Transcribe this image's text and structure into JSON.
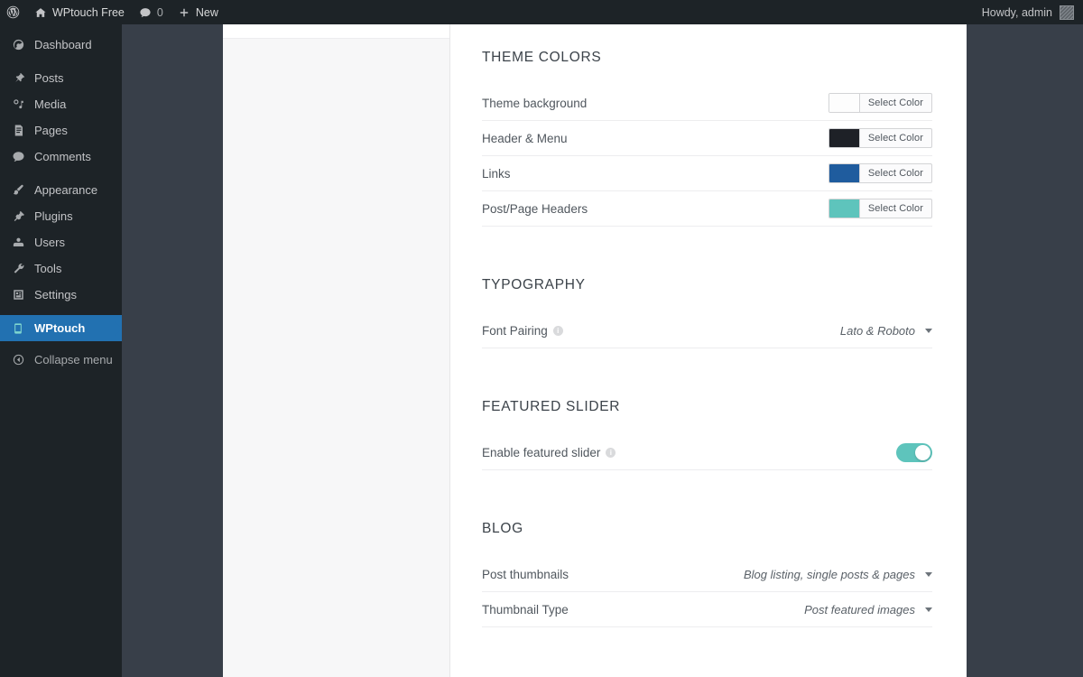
{
  "adminbar": {
    "logo_icon": "wordpress-logo-icon",
    "site_icon": "home-icon",
    "site_name": "WPtouch Free",
    "comments_icon": "comment-bubble-icon",
    "comments_count": "0",
    "new_icon": "plus-icon",
    "new_label": "New",
    "howdy": "Howdy, admin",
    "avatar_name": "user-avatar"
  },
  "sidebar": {
    "items": [
      {
        "label": "Dashboard",
        "icon": "dashboard-icon",
        "active": false
      },
      {
        "label": "Posts",
        "icon": "pin-icon",
        "active": false
      },
      {
        "label": "Media",
        "icon": "media-icon",
        "active": false
      },
      {
        "label": "Pages",
        "icon": "page-icon",
        "active": false
      },
      {
        "label": "Comments",
        "icon": "comment-bubble-icon",
        "active": false
      },
      {
        "label": "Appearance",
        "icon": "paintbrush-icon",
        "active": false
      },
      {
        "label": "Plugins",
        "icon": "plug-icon",
        "active": false
      },
      {
        "label": "Users",
        "icon": "users-icon",
        "active": false
      },
      {
        "label": "Tools",
        "icon": "wrench-icon",
        "active": false
      },
      {
        "label": "Settings",
        "icon": "settings-sliders-icon",
        "active": false
      },
      {
        "label": "WPtouch",
        "icon": "wptouch-icon",
        "active": true
      }
    ],
    "collapse": {
      "label": "Collapse menu",
      "icon": "collapse-arrow-icon"
    }
  },
  "main": {
    "sections": [
      {
        "title": "THEME COLORS",
        "rows": [
          {
            "label": "Theme background",
            "control": "colorpicker",
            "button_label": "Select Color",
            "swatch": "#fdfdfd"
          },
          {
            "label": "Header & Menu",
            "control": "colorpicker",
            "button_label": "Select Color",
            "swatch": "#1e2127"
          },
          {
            "label": "Links",
            "control": "colorpicker",
            "button_label": "Select Color",
            "swatch": "#1f5c9e"
          },
          {
            "label": "Post/Page Headers",
            "control": "colorpicker",
            "button_label": "Select Color",
            "swatch": "#5ec4bc"
          }
        ]
      },
      {
        "title": "TYPOGRAPHY",
        "rows": [
          {
            "label": "Font Pairing",
            "info": true,
            "control": "select",
            "value": "Lato & Roboto"
          }
        ]
      },
      {
        "title": "FEATURED SLIDER",
        "rows": [
          {
            "label": "Enable featured slider",
            "info": true,
            "control": "toggle",
            "value": "on"
          }
        ]
      },
      {
        "title": "BLOG",
        "rows": [
          {
            "label": "Post thumbnails",
            "control": "select",
            "value": "Blog listing, single posts & pages"
          },
          {
            "label": "Thumbnail Type",
            "control": "select",
            "value": "Post featured images"
          }
        ]
      }
    ]
  },
  "colors": {
    "admin_bar": "#1d2327",
    "sidebar": "#1d2327",
    "active_menu": "#2271b1",
    "panel_dark": "#383f49",
    "panel_list": "#f7f7f8",
    "accent_teal": "#5ec4bc"
  }
}
